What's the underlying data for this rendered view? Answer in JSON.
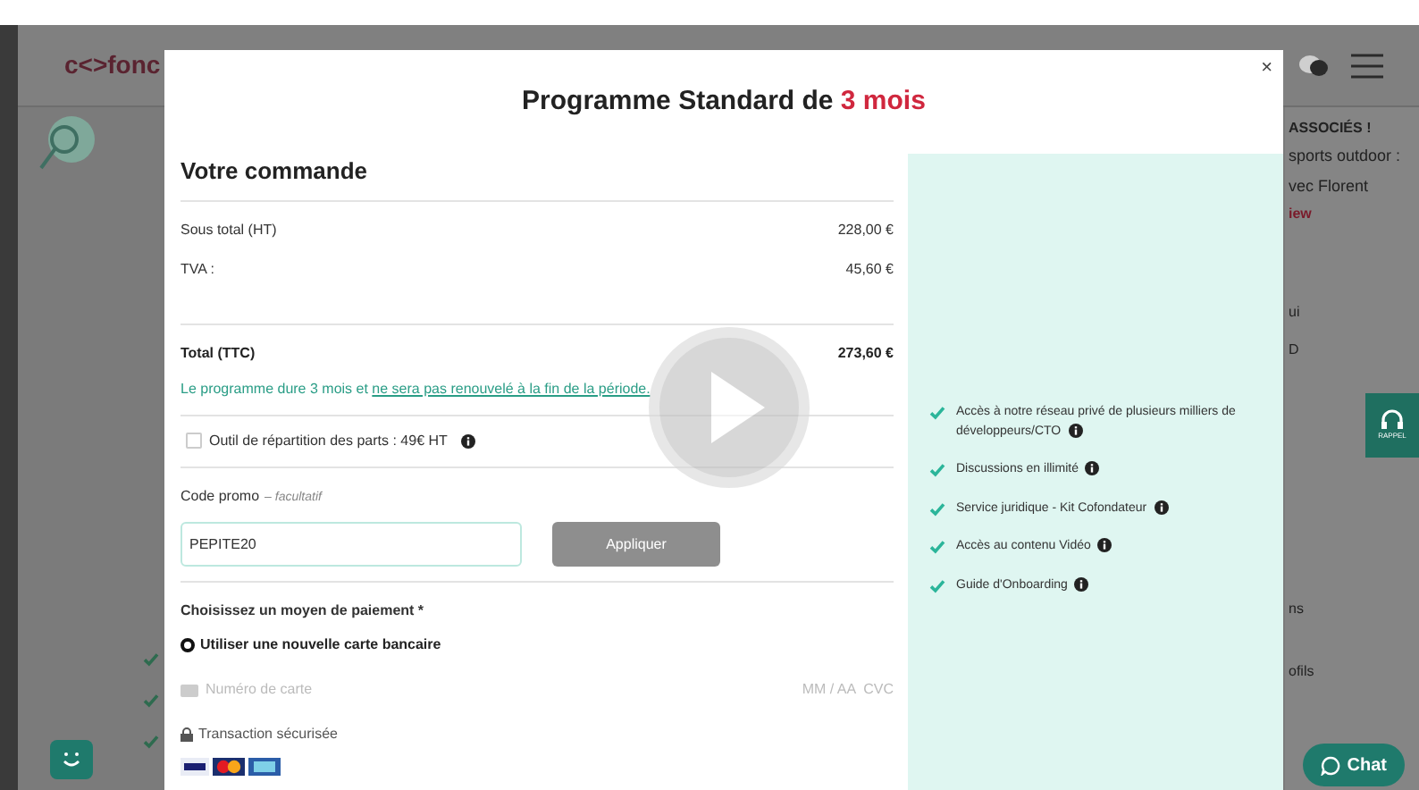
{
  "background": {
    "logo": "c<>fonc",
    "side_texts": [
      "ASSOCIÉS !",
      "sports outdoor :",
      "vec Florent",
      "iew",
      "ui",
      "D",
      "ns",
      "ofils"
    ],
    "rappel": "RAPPEL",
    "chat": "Chat"
  },
  "modal": {
    "close": "×",
    "title": "Programme Standard de ",
    "title_highlight": "3 mois",
    "order": {
      "heading": "Votre commande",
      "lines": [
        {
          "label": "Sous total (HT)",
          "value": "228,00 €"
        },
        {
          "label": "TVA :",
          "value": "45,60 €"
        }
      ],
      "total": {
        "label": "Total (TTC)",
        "value": "273,60 €"
      },
      "notice": "Le programme dure 3 mois et ",
      "notice_link": "ne sera pas renouvelé à la fin de la période."
    },
    "option": {
      "label": "Outil de répartition des parts : 49€ HT",
      "checked": false
    },
    "promo": {
      "label": "Code promo",
      "hint": "– facultatif",
      "value": "PEPITE20",
      "button": "Appliquer",
      "disabled": true
    },
    "payment": {
      "label": "Choisissez un moyen de paiement *",
      "method": "Utiliser une nouvelle carte bancaire",
      "selected": true,
      "card_placeholder": "Numéro de carte",
      "expiry_placeholder": "MM / AA",
      "cvc_placeholder": "CVC",
      "secure": "Transaction sécurisée"
    },
    "features": [
      "Accès à notre réseau privé de plusieurs milliers de développeurs/CTO",
      "Discussions en illimité",
      "Service juridique - Kit Cofondateur",
      "Accès au contenu Vidéo",
      "Guide d'Onboarding"
    ]
  }
}
